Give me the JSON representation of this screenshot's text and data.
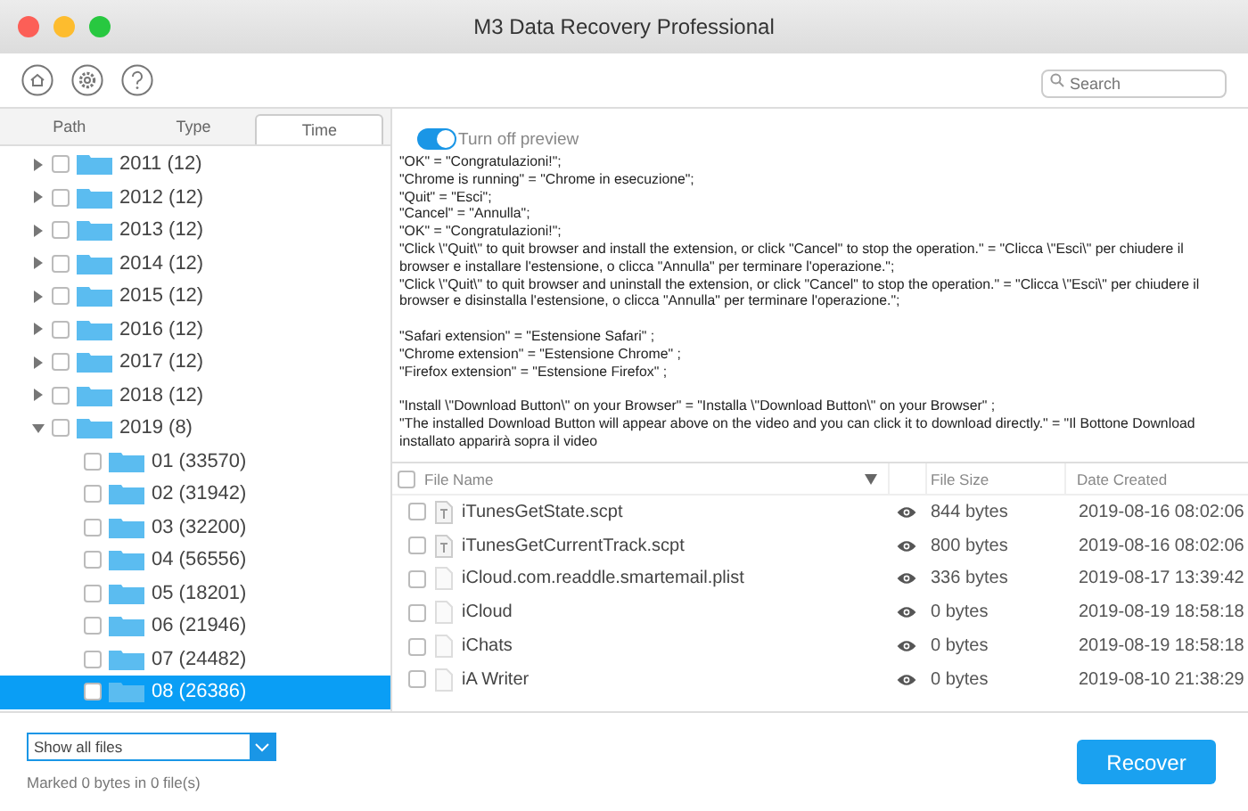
{
  "window": {
    "title": "M3 Data Recovery Professional"
  },
  "toolbar": {
    "search": {
      "placeholder": "Search"
    }
  },
  "tabs": [
    {
      "label": "Path",
      "selected": false
    },
    {
      "label": "Type",
      "selected": false
    },
    {
      "label": "Time",
      "selected": true
    }
  ],
  "tree": [
    {
      "label": "2011 (12)",
      "checked": false,
      "expanded": false,
      "selected": false
    },
    {
      "label": "2012 (12)",
      "checked": false,
      "expanded": false,
      "selected": false
    },
    {
      "label": "2013 (12)",
      "checked": false,
      "expanded": false,
      "selected": false
    },
    {
      "label": "2014 (12)",
      "checked": false,
      "expanded": false,
      "selected": false
    },
    {
      "label": "2015 (12)",
      "checked": false,
      "expanded": false,
      "selected": false
    },
    {
      "label": "2016 (12)",
      "checked": false,
      "expanded": false,
      "selected": false
    },
    {
      "label": "2017 (12)",
      "checked": false,
      "expanded": false,
      "selected": false
    },
    {
      "label": "2018 (12)",
      "checked": false,
      "expanded": false,
      "selected": false
    },
    {
      "label": "2019 (8)",
      "checked": false,
      "expanded": true,
      "selected": false,
      "children": [
        {
          "label": "01 (33570)",
          "checked": false,
          "selected": false
        },
        {
          "label": "02 (31942)",
          "checked": false,
          "selected": false
        },
        {
          "label": "03 (32200)",
          "checked": false,
          "selected": false
        },
        {
          "label": "04 (56556)",
          "checked": false,
          "selected": false
        },
        {
          "label": "05 (18201)",
          "checked": false,
          "selected": false
        },
        {
          "label": "06 (21946)",
          "checked": false,
          "selected": false
        },
        {
          "label": "07 (24482)",
          "checked": false,
          "selected": false
        },
        {
          "label": "08 (26386)",
          "checked": false,
          "selected": true
        }
      ]
    }
  ],
  "preview": {
    "toggle": {
      "label": "Turn off preview",
      "on": true
    },
    "paragraphs": [
      [
        "\"OK\" = \"Congratulazioni!\";",
        "\"Chrome is running\" = \"Chrome in esecuzione\";",
        "\"Quit\" = \"Esci\";",
        "\"Cancel\" = \"Annulla\";",
        "\"OK\" = \"Congratulazioni!\";",
        "\"Click \\\"Quit\\\" to quit browser and install the extension, or click \"Cancel\" to stop the operation.\" = \"Clicca \\\"Esci\\\" per chiudere il browser e installare l'estensione, o clicca \"Annulla\" per terminare l'operazione.\";",
        "\"Click \\\"Quit\\\" to quit browser and uninstall the extension, or click \"Cancel\" to stop the operation.\" = \"Clicca \\\"Esci\\\" per chiudere il browser e disinstalla l'estensione, o clicca \"Annulla\" per terminare l'operazione.\";"
      ],
      [
        "\"Safari extension\" = \"Estensione Safari\" ;",
        "\"Chrome extension\" = \"Estensione Chrome\" ;",
        "\"Firefox extension\" = \"Estensione Firefox\" ;"
      ],
      [
        "\"Install \\\"Download Button\\\" on your Browser\" = \"Installa \\\"Download Button\\\" on your Browser\" ;",
        "\"The installed Download Button will appear above on the video and you can click it to download directly.\" = \"Il Bottone Download installato apparirà sopra il video"
      ]
    ]
  },
  "table": {
    "select_all": {
      "checked": false
    },
    "columns": [
      "File Name",
      "File Size",
      "Date Created"
    ],
    "rows": [
      {
        "kind": "script",
        "checked": false,
        "name": "iTunesGetState.scpt",
        "size": "844 bytes",
        "date": "2019-08-16 08:02:06"
      },
      {
        "kind": "script",
        "checked": false,
        "name": "iTunesGetCurrentTrack.scpt",
        "size": "800 bytes",
        "date": "2019-08-16 08:02:06"
      },
      {
        "kind": "document",
        "checked": false,
        "name": "iCloud.com.readdle.smartemail.plist",
        "size": "336 bytes",
        "date": "2019-08-17 13:39:42"
      },
      {
        "kind": "document",
        "checked": false,
        "name": "iCloud",
        "size": "0 bytes",
        "date": "2019-08-19 18:58:18"
      },
      {
        "kind": "document",
        "checked": false,
        "name": "iChats",
        "size": "0 bytes",
        "date": "2019-08-19 18:58:18"
      },
      {
        "kind": "document",
        "checked": false,
        "name": "iA Writer",
        "size": "0 bytes",
        "date": "2019-08-10 21:38:29"
      }
    ]
  },
  "footer": {
    "filter": "Show all files",
    "status": "Marked 0 bytes in 0 file(s)",
    "recover_button": "Recover"
  }
}
